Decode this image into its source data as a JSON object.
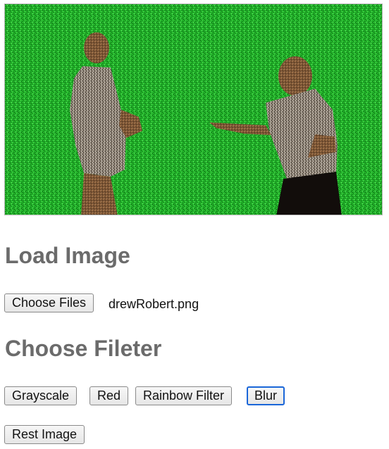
{
  "image": {
    "description_icon": "image-canvas",
    "background_color": "#22b32a"
  },
  "load_section": {
    "title": "Load Image",
    "choose_files_label": "Choose Files",
    "selected_file": "drewRobert.png"
  },
  "filter_section": {
    "title": "Choose Fileter",
    "buttons": [
      {
        "label": "Grayscale"
      },
      {
        "label": "Red"
      },
      {
        "label": "Rainbow Filter"
      },
      {
        "label": "Blur"
      }
    ],
    "focused_button": "Blur",
    "reset_label": "Rest Image"
  },
  "colors": {
    "heading": "#6b6b6b",
    "focus_ring": "#1a66d8",
    "green_screen": "#22b32a"
  }
}
